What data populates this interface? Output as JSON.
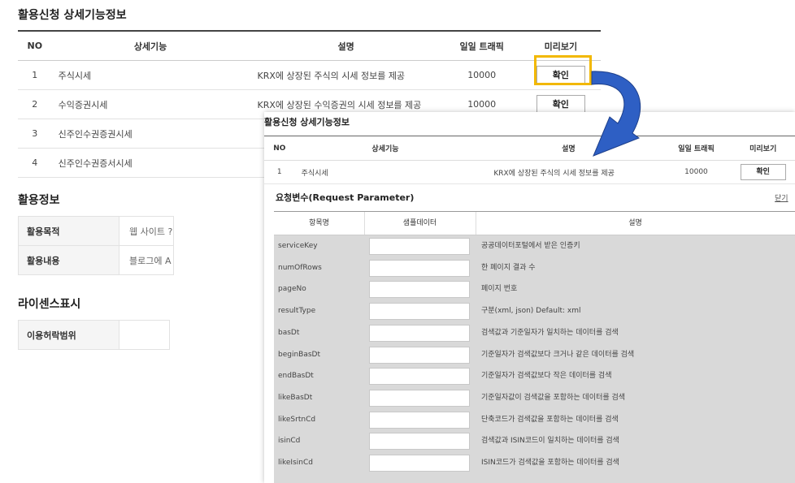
{
  "background": {
    "title": "활용신청 상세기능정보",
    "columns": [
      "NO",
      "상세기능",
      "설명",
      "일일 트래픽",
      "미리보기"
    ],
    "rows": [
      {
        "no": "1",
        "name": "주식시세",
        "desc": "KRX에 상장된 주식의 시세 정보를 제공",
        "traffic": "10000",
        "button": "확인"
      },
      {
        "no": "2",
        "name": "수익증권시세",
        "desc": "KRX에 상장된 수익증권의 시세 정보를 제공",
        "traffic": "10000",
        "button": "확인"
      },
      {
        "no": "3",
        "name": "신주인수권증권시세"
      },
      {
        "no": "4",
        "name": "신주인수권증서시세"
      }
    ],
    "usage_title": "활용정보",
    "usage_rows": [
      {
        "label": "활용목적",
        "value": "웹 사이트 ?"
      },
      {
        "label": "활용내용",
        "value": "블로그에 A"
      }
    ],
    "license_title": "라이센스표시",
    "license_rows": [
      {
        "label": "이용허락범위",
        "value": ""
      }
    ]
  },
  "overlay": {
    "title": "활용신청 상세기능정보",
    "columns": [
      "NO",
      "상세기능",
      "설명",
      "일일 트래픽",
      "미리보기"
    ],
    "row": {
      "no": "1",
      "name": "주식시세",
      "desc": "KRX에 상장된 주식의 시세 정보를 제공",
      "traffic": "10000",
      "button": "확인"
    },
    "param_title": "요청변수(Request Parameter)",
    "close_label": "닫기",
    "param_columns": [
      "항목명",
      "샘플데이터",
      "설명"
    ],
    "params": [
      {
        "name": "serviceKey",
        "desc": "공공데이터포털에서 받은 인증키"
      },
      {
        "name": "numOfRows",
        "desc": "한 페이지 결과 수"
      },
      {
        "name": "pageNo",
        "desc": "페이지 번호"
      },
      {
        "name": "resultType",
        "desc": "구분(xml, json) Default: xml"
      },
      {
        "name": "basDt",
        "desc": "검색값과 기준일자가 일치하는 데이터를 검색"
      },
      {
        "name": "beginBasDt",
        "desc": "기준일자가 검색값보다 크거나 같은 데이터를 검색"
      },
      {
        "name": "endBasDt",
        "desc": "기준일자가 검색값보다 작은 데이터를 검색"
      },
      {
        "name": "likeBasDt",
        "desc": "기준일자값이 검색값을 포함하는 데이터를 검색"
      },
      {
        "name": "likeSrtnCd",
        "desc": "단축코드가 검색값을 포함하는 데이터를 검색"
      },
      {
        "name": "isinCd",
        "desc": "검색값과 ISIN코드이 일치하는 데이터를 검색"
      },
      {
        "name": "likeIsinCd",
        "desc": "ISIN코드가 검색값을 포함하는 데이터를 검색"
      }
    ]
  },
  "colors": {
    "highlight": "#f2b800",
    "arrow": "#2e5fc4"
  }
}
